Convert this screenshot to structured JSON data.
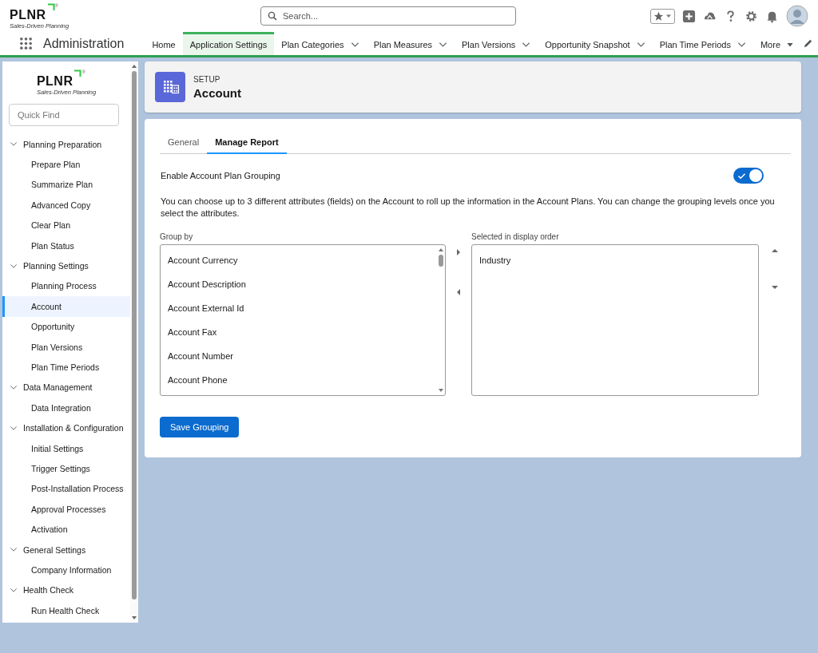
{
  "header": {
    "logo": {
      "name": "PLNR",
      "mark": "®",
      "tagline": "Sales-Driven Planning"
    },
    "search": {
      "placeholder": "Search..."
    }
  },
  "nav": {
    "app_name": "Administration",
    "tabs": [
      {
        "label": "Home",
        "selected": false,
        "has_menu": false
      },
      {
        "label": "Application Settings",
        "selected": true,
        "has_menu": false
      },
      {
        "label": "Plan Categories",
        "selected": false,
        "has_menu": true
      },
      {
        "label": "Plan Measures",
        "selected": false,
        "has_menu": true
      },
      {
        "label": "Plan Versions",
        "selected": false,
        "has_menu": true
      },
      {
        "label": "Opportunity Snapshot",
        "selected": false,
        "has_menu": true
      },
      {
        "label": "Plan Time Periods",
        "selected": false,
        "has_menu": true
      }
    ],
    "more": "More"
  },
  "sidebar": {
    "logo": {
      "name": "PLNR",
      "mark": "®",
      "tagline": "Sales-Driven Planning"
    },
    "search": {
      "placeholder": "Quick Find"
    },
    "groups": [
      {
        "label": "Planning Preparation",
        "expanded": true,
        "children": [
          {
            "label": "Prepare Plan",
            "selected": false
          },
          {
            "label": "Summarize Plan",
            "selected": false
          },
          {
            "label": "Advanced Copy",
            "selected": false
          },
          {
            "label": "Clear Plan",
            "selected": false
          },
          {
            "label": "Plan Status",
            "selected": false
          }
        ]
      },
      {
        "label": "Planning Settings",
        "expanded": true,
        "children": [
          {
            "label": "Planning Process",
            "selected": false
          },
          {
            "label": "Account",
            "selected": true
          },
          {
            "label": "Opportunity",
            "selected": false
          },
          {
            "label": "Plan Versions",
            "selected": false
          },
          {
            "label": "Plan Time Periods",
            "selected": false
          }
        ]
      },
      {
        "label": "Data Management",
        "expanded": true,
        "children": [
          {
            "label": "Data Integration",
            "selected": false
          }
        ]
      },
      {
        "label": "Installation & Configuration",
        "expanded": true,
        "children": [
          {
            "label": "Initial Settings",
            "selected": false
          },
          {
            "label": "Trigger Settings",
            "selected": false
          },
          {
            "label": "Post-Installation Process",
            "selected": false
          },
          {
            "label": "Approval Processes",
            "selected": false
          },
          {
            "label": "Activation",
            "selected": false
          }
        ]
      },
      {
        "label": "General Settings",
        "expanded": true,
        "children": [
          {
            "label": "Company Information",
            "selected": false
          }
        ]
      },
      {
        "label": "Health Check",
        "expanded": true,
        "children": [
          {
            "label": "Run Health Check",
            "selected": false
          }
        ]
      }
    ]
  },
  "page_header": {
    "eyebrow": "SETUP",
    "title": "Account"
  },
  "tabs": [
    {
      "label": "General",
      "selected": false
    },
    {
      "label": "Manage Report",
      "selected": true
    }
  ],
  "grouping": {
    "label": "Enable Account Plan Grouping",
    "on": true,
    "description": "You can choose up to 3 different attributes (fields) on the Account to roll up the information in the Account Plans. You can change the grouping levels once you select the attributes.",
    "available": {
      "label": "Group by",
      "items": [
        "Account Currency",
        "Account Description",
        "Account External Id",
        "Account Fax",
        "Account Number",
        "Account Phone"
      ]
    },
    "selected": {
      "label": "Selected in display order",
      "items": [
        "Industry"
      ]
    },
    "save": "Save Grouping"
  }
}
